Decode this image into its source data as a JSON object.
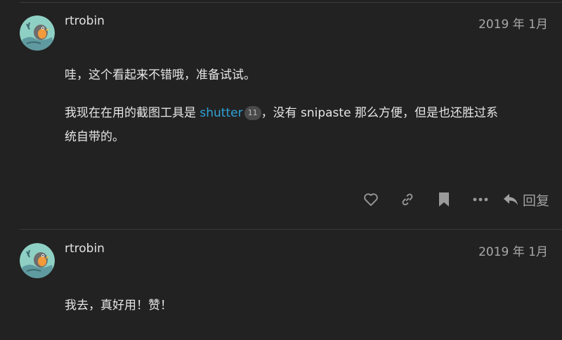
{
  "posts": [
    {
      "username": "rtrobin",
      "date": "2019 年 1月",
      "paragraph1": "哇，这个看起来不错哦，准备试试。",
      "paragraph2_pre": "我现在在用的截图工具是 ",
      "link_text": "shutter",
      "link_badge": "11",
      "paragraph2_post_line1": "，没有 snipaste 那么方便，但是也还胜过系",
      "paragraph2_post_line2": "统自带的。",
      "reply_label": "回复"
    },
    {
      "username": "rtrobin",
      "date": "2019 年 1月",
      "paragraph1": "我去，真好用！赞！"
    }
  ],
  "icons": {
    "like": "heart-icon",
    "share": "link-icon",
    "bookmark": "bookmark-icon",
    "more": "ellipsis-icon",
    "reply": "reply-arrow-icon"
  },
  "colors": {
    "background": "#222222",
    "link": "#2fa3d8",
    "muted": "#9a9a9a"
  }
}
